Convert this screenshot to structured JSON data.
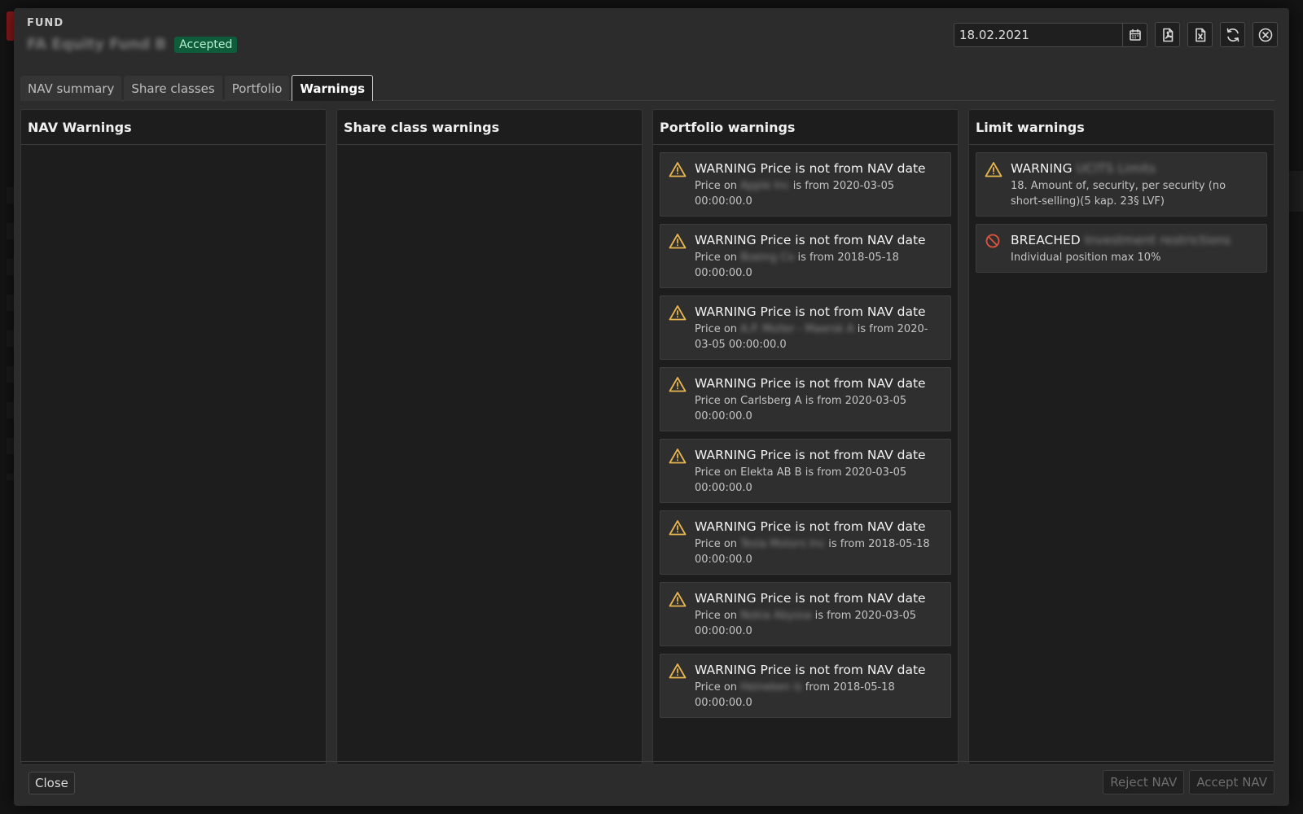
{
  "modal": {
    "eyebrow": "FUND",
    "fund_name": "FA Equity Fund B",
    "status": "Accepted"
  },
  "toolbar": {
    "date_value": "18.02.2021",
    "icons": [
      "calendar-icon",
      "pdf-export-icon",
      "excel-export-icon",
      "refresh-icon",
      "close-circle-icon"
    ]
  },
  "tabs": [
    {
      "label": "NAV summary",
      "active": false
    },
    {
      "label": "Share classes",
      "active": false
    },
    {
      "label": "Portfolio",
      "active": false
    },
    {
      "label": "Warnings",
      "active": true
    }
  ],
  "panels": {
    "nav": {
      "title": "NAV Warnings"
    },
    "share_class": {
      "title": "Share class warnings"
    },
    "portfolio": {
      "title": "Portfolio warnings",
      "items": [
        {
          "title": "WARNING Price is not from NAV date",
          "prefix": "Price on",
          "security": "Apple Inc",
          "suffix": "is from 2020-03-05 00:00:00.0"
        },
        {
          "title": "WARNING Price is not from NAV date",
          "prefix": "Price on",
          "security": "Boeing Co",
          "suffix": "is from 2018-05-18 00:00:00.0"
        },
        {
          "title": "WARNING Price is not from NAV date",
          "prefix": "Price on",
          "security": "A.P. Moller - Maersk A",
          "suffix": "is from 2020-03-05 00:00:00.0"
        },
        {
          "title": "WARNING Price is not from NAV date",
          "prefix": "Price on Carlsberg A",
          "security": "",
          "suffix": "is from 2020-03-05 00:00:00.0"
        },
        {
          "title": "WARNING Price is not from NAV date",
          "prefix": "Price on Elekta AB B",
          "security": "",
          "suffix": "is from 2020-03-05 00:00:00.0"
        },
        {
          "title": "WARNING Price is not from NAV date",
          "prefix": "Price on",
          "security": "Tesla Motors Inc",
          "suffix": "is from 2018-05-18 00:00:00.0"
        },
        {
          "title": "WARNING Price is not from NAV date",
          "prefix": "Price on",
          "security": "Nokia Abyssa",
          "suffix": "is from 2020-03-05 00:00:00.0"
        },
        {
          "title": "WARNING Price is not from NAV date",
          "prefix": "Price on",
          "security": "Heineken is",
          "suffix": "from 2018-05-18 00:00:00.0"
        }
      ]
    },
    "limit": {
      "title": "Limit warnings",
      "items": [
        {
          "type": "warning",
          "label": "WARNING",
          "name": "UCITS Limits",
          "detail": "18. Amount of, security, per security (no short-selling)(5 kap. 23§ LVF)"
        },
        {
          "type": "breached",
          "label": "BREACHED",
          "name": "Investment restrictions",
          "detail": "Individual position max 10%"
        }
      ]
    }
  },
  "footer": {
    "close_label": "Close",
    "reject_label": "Reject NAV",
    "accept_label": "Accept NAV"
  },
  "colors": {
    "warning_icon": "#e8b64c",
    "breached_icon": "#e0533f",
    "accepted_badge": "#0f5c3a"
  }
}
